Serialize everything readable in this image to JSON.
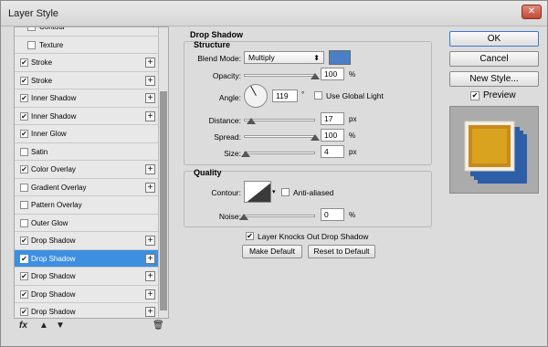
{
  "window": {
    "title": "Layer Style",
    "close_glyph": "✕"
  },
  "styles": {
    "items": [
      {
        "label": "Contour",
        "checked": false,
        "indent": true,
        "plus": false,
        "selected": false
      },
      {
        "label": "Texture",
        "checked": false,
        "indent": true,
        "plus": false,
        "selected": false
      },
      {
        "label": "Stroke",
        "checked": true,
        "indent": false,
        "plus": true,
        "selected": false
      },
      {
        "label": "Stroke",
        "checked": true,
        "indent": false,
        "plus": true,
        "selected": false
      },
      {
        "label": "Inner Shadow",
        "checked": true,
        "indent": false,
        "plus": true,
        "selected": false
      },
      {
        "label": "Inner Shadow",
        "checked": true,
        "indent": false,
        "plus": true,
        "selected": false
      },
      {
        "label": "Inner Glow",
        "checked": true,
        "indent": false,
        "plus": false,
        "selected": false
      },
      {
        "label": "Satin",
        "checked": false,
        "indent": false,
        "plus": false,
        "selected": false
      },
      {
        "label": "Color Overlay",
        "checked": true,
        "indent": false,
        "plus": true,
        "selected": false
      },
      {
        "label": "Gradient Overlay",
        "checked": false,
        "indent": false,
        "plus": true,
        "selected": false
      },
      {
        "label": "Pattern Overlay",
        "checked": false,
        "indent": false,
        "plus": false,
        "selected": false
      },
      {
        "label": "Outer Glow",
        "checked": false,
        "indent": false,
        "plus": false,
        "selected": false
      },
      {
        "label": "Drop Shadow",
        "checked": true,
        "indent": false,
        "plus": true,
        "selected": false
      },
      {
        "label": "Drop Shadow",
        "checked": true,
        "indent": false,
        "plus": true,
        "selected": true
      },
      {
        "label": "Drop Shadow",
        "checked": true,
        "indent": false,
        "plus": true,
        "selected": false
      },
      {
        "label": "Drop Shadow",
        "checked": true,
        "indent": false,
        "plus": true,
        "selected": false
      },
      {
        "label": "Drop Shadow",
        "checked": true,
        "indent": false,
        "plus": true,
        "selected": false
      }
    ],
    "bottom_icons": {
      "fx": "fx",
      "up": "▲",
      "down": "▼",
      "trash": "🗑"
    }
  },
  "drop_shadow": {
    "heading": "Drop Shadow",
    "structure": {
      "title": "Structure",
      "blend_mode_label": "Blend Mode:",
      "blend_mode_value": "Multiply",
      "color": "#4a7fc6",
      "opacity_label": "Opacity:",
      "opacity_value": "100",
      "opacity_unit": "%",
      "opacity_fraction": 1.0,
      "angle_label": "Angle:",
      "angle_value": "119",
      "angle_unit": "°",
      "global_light_label": "Use Global Light",
      "distance_label": "Distance:",
      "distance_value": "17",
      "distance_unit": "px",
      "distance_fraction": 0.1,
      "spread_label": "Spread:",
      "spread_value": "100",
      "spread_unit": "%",
      "spread_fraction": 1.0,
      "size_label": "Size:",
      "size_value": "4",
      "size_unit": "px",
      "size_fraction": 0.03
    },
    "quality": {
      "title": "Quality",
      "contour_label": "Contour:",
      "anti_aliased_label": "Anti-aliased",
      "noise_label": "Noise:",
      "noise_value": "0",
      "noise_unit": "%",
      "noise_fraction": 0.0
    },
    "knockout_label": "Layer Knocks Out Drop Shadow",
    "make_default": "Make Default",
    "reset_default": "Reset to Default"
  },
  "actions": {
    "ok": "OK",
    "cancel": "Cancel",
    "new_style": "New Style...",
    "preview_label": "Preview"
  },
  "preview_colors": {
    "face": "#d9a320",
    "rim": "#c98a1a",
    "shadow": "#2d5ea8"
  }
}
